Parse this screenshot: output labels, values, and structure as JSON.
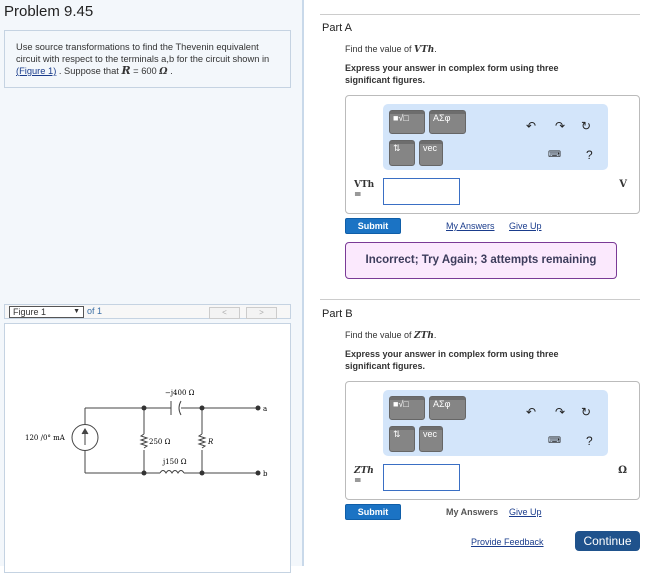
{
  "problem": {
    "title": "Problem 9.45",
    "text_before": "Use source transformations to find the Thevenin equivalent circuit with respect to the terminals a,b for the circuit shown in ",
    "figure_link": "(Figure 1)",
    "text_mid": " . Suppose that ",
    "R_symbol": "R",
    "text_value": " = 600 ",
    "unit": "Ω",
    "text_end": " ."
  },
  "figure": {
    "selector": "Figure 1",
    "of": "of 1",
    "prev": "<",
    "next": ">",
    "labels": {
      "capacitor": "−j400 Ω",
      "source": "120 /0° mA",
      "r250": "250 Ω",
      "R": "R",
      "inductor": "j150 Ω",
      "a": "a",
      "b": "b"
    }
  },
  "toolbar": {
    "templates": "■√□",
    "greek": "ΑΣφ",
    "arrows": "⇅",
    "vec": "vec",
    "undo": "undo",
    "redo": "redo",
    "reset": "reset",
    "keyboard": "keyboard",
    "help": "?"
  },
  "partA": {
    "title": "Part A",
    "find": "Find the value of ",
    "var": "VTh",
    "express": "Express your answer in complex form using three significant figures.",
    "label": "VTh",
    "eq": "=",
    "unit": "V",
    "input_value": "",
    "submit": "Submit",
    "my_answers": "My Answers",
    "give_up": "Give Up",
    "feedback": "Incorrect; Try Again; 3 attempts remaining"
  },
  "partB": {
    "title": "Part B",
    "find": "Find the value of ",
    "var": "ZTh",
    "express": "Express your answer in complex form using three significant figures.",
    "label": "ZTh",
    "eq": "=",
    "unit": "Ω",
    "input_value": "",
    "submit": "Submit",
    "my_answers": "My Answers",
    "give_up": "Give Up"
  },
  "footer": {
    "provide_feedback": "Provide Feedback",
    "continue": "Continue"
  }
}
